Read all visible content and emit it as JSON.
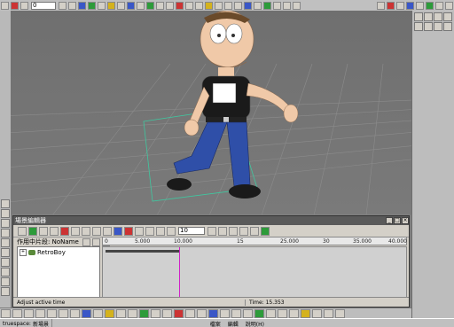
{
  "top_toolbar": {
    "frame_value": "0"
  },
  "dialog": {
    "title": "場景編輯器",
    "min": "_",
    "max": "□",
    "close": "×",
    "frame_value": "10",
    "active_label": "作用中片段: NoName",
    "ruler_ticks": [
      "0",
      "5.000",
      "10.000",
      "15",
      "25.000",
      "30",
      "35.000",
      "40.000"
    ],
    "tree_item": "RetroBoy",
    "status_message": "Adjust active time",
    "status_time": "Time: 15.353"
  },
  "taskbar": {
    "app": "truespace:",
    "app_sub": "新場景",
    "menu_file": "檔案",
    "menu_edit": "編輯",
    "menu_help": "說明(H)"
  },
  "colors": {
    "viewport_bg": "#777777",
    "grid_line": "#8a8a8a",
    "timeline_cursor": "#d020c8",
    "jeans": "#2f4fa8",
    "shirt": "#1a1a1a",
    "skin": "#f0c9a8"
  }
}
